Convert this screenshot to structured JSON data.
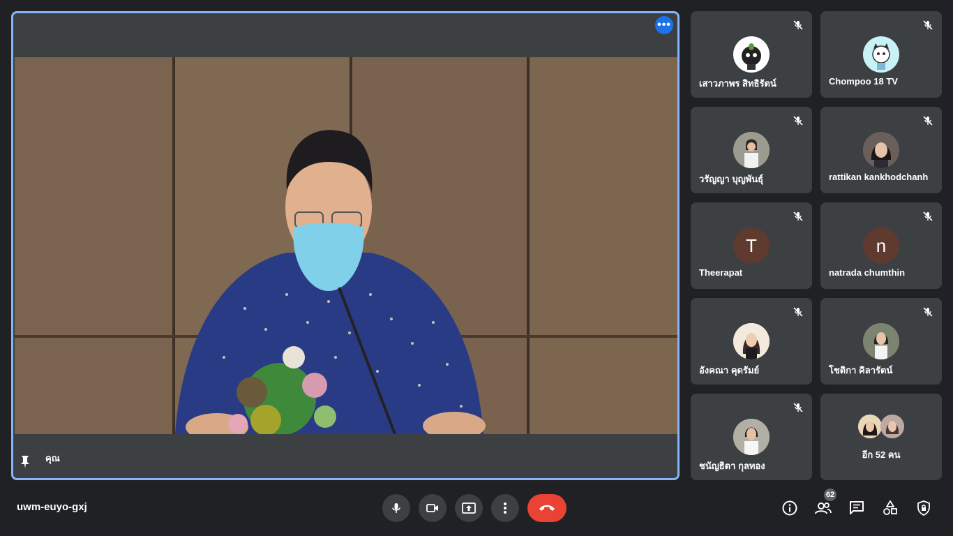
{
  "main": {
    "presenter_label": "คุณ"
  },
  "participants": [
    {
      "name": "เสาวภาพร สิทธิรัตน์",
      "avatar": "photo"
    },
    {
      "name": "Chompoo 18 TV",
      "avatar": "photo"
    },
    {
      "name": "วรัญญา บุญพันธุ์",
      "avatar": "photo"
    },
    {
      "name": "rattikan kankhodchanh",
      "avatar": "photo"
    },
    {
      "name": "Theerapat",
      "avatar": "letter",
      "letter": "T",
      "color": "#5f3a2e"
    },
    {
      "name": "natrada chumthin",
      "avatar": "letter",
      "letter": "n",
      "color": "#5f3a2e"
    },
    {
      "name": "อังคณา คุดรัมย์",
      "avatar": "photo"
    },
    {
      "name": "โชติกา คิลารัตน์",
      "avatar": "photo"
    },
    {
      "name": "ชนัญธิดา กุลทอง",
      "avatar": "photo"
    }
  ],
  "more_tile": {
    "label": "อีก 52 คน"
  },
  "footer": {
    "meeting_code": "uwm-euyo-gxj",
    "people_count": "62"
  },
  "colors": {
    "accent": "#8ab4f8",
    "hangup": "#ea4335",
    "more_button": "#1a73e8",
    "background": "#202124",
    "tile": "#3c4043"
  },
  "icons": {
    "mute": "mic-off-icon",
    "mic": "mic-icon",
    "camera": "camera-icon",
    "present": "present-screen-icon",
    "more": "more-vert-icon",
    "hangup": "phone-hangup-icon",
    "info": "info-icon",
    "people": "people-icon",
    "chat": "chat-icon",
    "activities": "shapes-icon",
    "host": "shield-lock-icon",
    "pin": "pin-icon"
  }
}
